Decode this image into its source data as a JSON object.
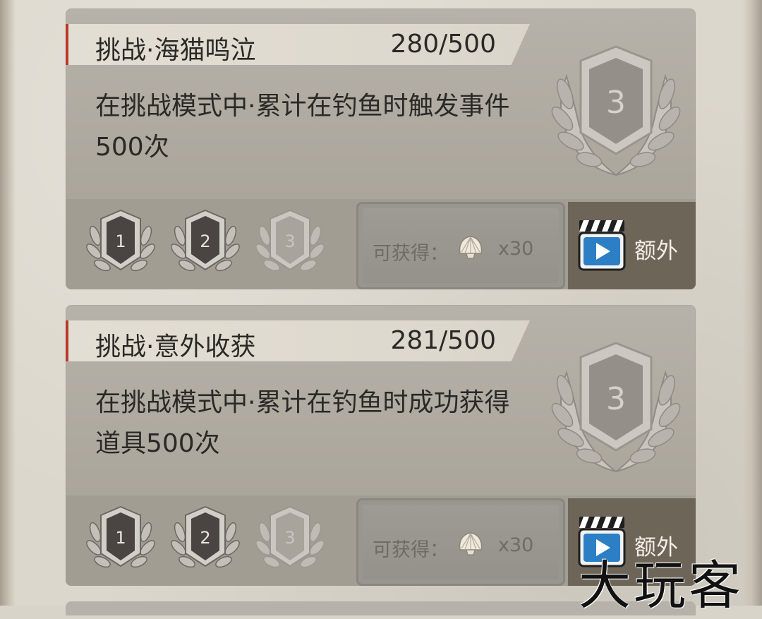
{
  "achievements": [
    {
      "title": "挑战·海猫鸣泣",
      "progress": "280/500",
      "description_line1": "在挑战模式中·累计在钓鱼时触发事件",
      "description_line2": "500次",
      "current_tier_label": "3",
      "tiers": [
        {
          "label": "1",
          "state": "earned"
        },
        {
          "label": "2",
          "state": "earned"
        },
        {
          "label": "3",
          "state": "locked"
        }
      ],
      "reward_label": "可获得：",
      "reward_icon": "shell-icon",
      "reward_qty": "x30",
      "extra_label": "额外",
      "extra_icon": "video-clapper-icon"
    },
    {
      "title": "挑战·意外收获",
      "progress": "281/500",
      "description_line1": "在挑战模式中·累计在钓鱼时成功获得",
      "description_line2": "道具500次",
      "current_tier_label": "3",
      "tiers": [
        {
          "label": "1",
          "state": "earned"
        },
        {
          "label": "2",
          "state": "earned"
        },
        {
          "label": "3",
          "state": "locked"
        }
      ],
      "reward_label": "可获得：",
      "reward_icon": "shell-icon",
      "reward_qty": "x30",
      "extra_label": "额外",
      "extra_icon": "video-clapper-icon"
    }
  ],
  "watermark": "大玩客",
  "colors": {
    "title_accent": "#b73a2a",
    "extra_button": "#6e6559",
    "medal_earned": "#4a4442",
    "medal_locked": "#a8a39b"
  }
}
